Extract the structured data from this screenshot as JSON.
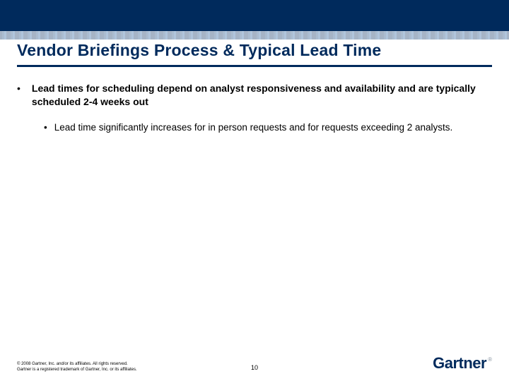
{
  "title": "Vendor Briefings Process & Typical Lead Time",
  "bullets": {
    "l1": "Lead times for scheduling depend on analyst responsiveness and availability and are typically scheduled 2-4 weeks out",
    "l2": "Lead time significantly increases for in person requests and for requests exceeding 2 analysts."
  },
  "footer": {
    "copyright_line1": "© 2008 Gartner, Inc. and/or its affiliates. All rights reserved.",
    "copyright_line2": "Gartner is a registered trademark of Gartner, Inc. or its affiliates.",
    "page_number": "10",
    "logo_text": "Gartner",
    "logo_reg": "®"
  }
}
